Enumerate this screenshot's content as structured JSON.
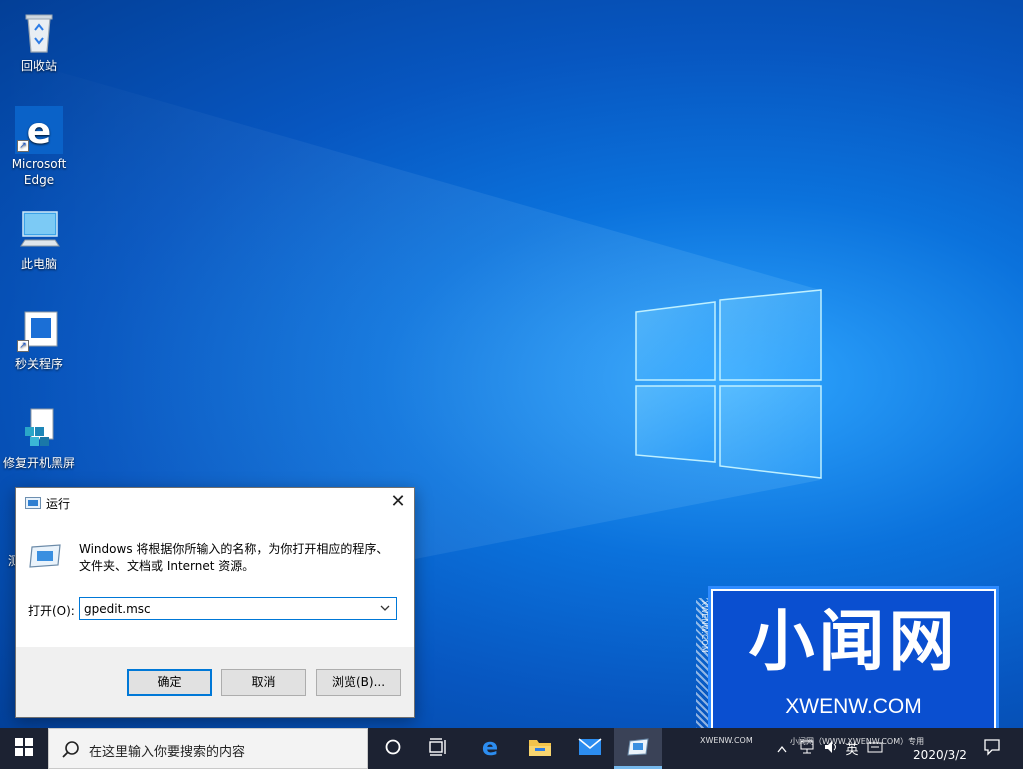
{
  "desktop": {
    "icons": [
      {
        "label": "回收站",
        "icon": "recycle-bin-icon"
      },
      {
        "label": "Microsoft Edge",
        "icon": "edge-icon"
      },
      {
        "label": "此电脑",
        "icon": "this-pc-icon"
      },
      {
        "label": "秒关程序",
        "icon": "app-shortcut-icon"
      },
      {
        "label": "修复开机黑屏",
        "icon": "repair-tool-icon"
      },
      {
        "label": "测",
        "icon": "partial-icon"
      }
    ]
  },
  "run_dialog": {
    "title": "运行",
    "description": "Windows 将根据你所输入的名称，为你打开相应的程序、文件夹、文档或 Internet 资源。",
    "open_label": "打开(O):",
    "command_value": "gpedit.msc",
    "ok_label": "确定",
    "cancel_label": "取消",
    "browse_label": "浏览(B)..."
  },
  "watermark": {
    "title": "小闻网",
    "url": "XWENW.COM",
    "side_text": "XWENW.COM",
    "small_text": "XWENW.COM",
    "tray_line": "小闻网（WWW.XWENW.COM）专用"
  },
  "taskbar": {
    "search_placeholder": "在这里输入你要搜索的内容",
    "tray_lang": "英",
    "clock_date": "2020/3/2"
  },
  "colors": {
    "desktop_blue": "#0b72dc",
    "taskbar": "#1c2232",
    "accent": "#0078d7"
  }
}
